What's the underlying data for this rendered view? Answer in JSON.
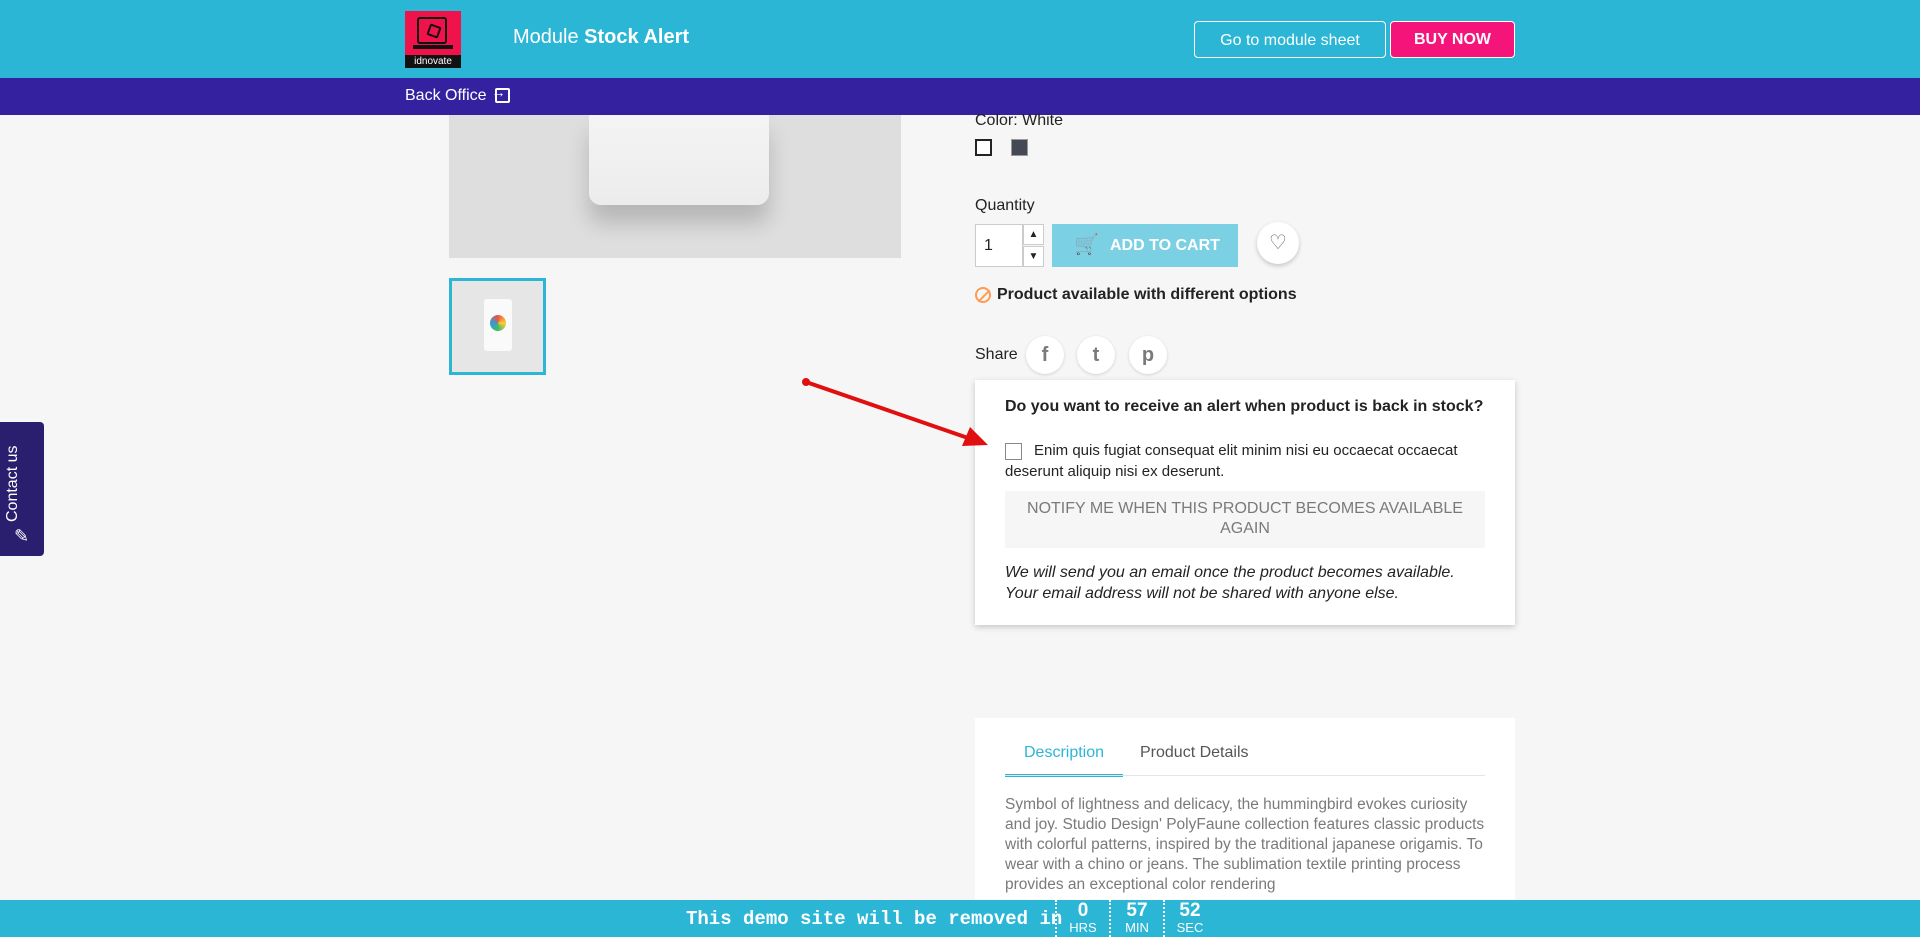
{
  "header": {
    "logo_text": "idnovate",
    "module_prefix": "Module",
    "module_name": "Stock Alert",
    "module_sheet_button": "Go to module sheet",
    "buy_button": "BUY NOW",
    "back_office_link": "Back Office"
  },
  "product": {
    "color_label": "Color: White",
    "color_swatches": [
      {
        "name": "White",
        "color": "#ffffff"
      },
      {
        "name": "Black",
        "color": "#434a54"
      }
    ],
    "quantity_label": "Quantity",
    "quantity_value": "1",
    "add_to_cart": "ADD TO CART",
    "availability": "Product available with different options",
    "share_label": "Share",
    "share_icons": [
      "facebook-icon",
      "twitter-icon",
      "pinterest-icon"
    ]
  },
  "stock_alert": {
    "question": "Do you want to receive an alert when product is back in stock?",
    "consent_text": "Enim quis fugiat consequat elit minim nisi eu occaecat occaecat deserunt aliquip nisi ex deserunt.",
    "notify_button": "NOTIFY ME WHEN THIS PRODUCT BECOMES AVAILABLE AGAIN",
    "note": "We will send you an email once the product becomes available. Your email address will not be shared with anyone else."
  },
  "tabs": {
    "description": "Description",
    "product_details": "Product Details",
    "description_text": "Symbol of lightness and delicacy, the hummingbird evokes curiosity and joy. Studio Design' PolyFaune collection features classic products with colorful patterns, inspired by the traditional japanese origamis. To wear with a chino or jeans. The sublimation textile printing process provides an exceptional color rendering"
  },
  "contact_tab": "Contact us",
  "demo_bar": {
    "text": "This demo site will be removed in",
    "hours": "0",
    "hours_label": "HRS",
    "minutes": "57",
    "minutes_label": "MIN",
    "seconds": "52",
    "seconds_label": "SEC"
  },
  "colors": {
    "header_bg": "#2bb6d6",
    "subbar_bg": "#3321a0",
    "buy_button": "#f5157a",
    "add_to_cart": "#7cd0e4",
    "arrow": "#e01010"
  }
}
